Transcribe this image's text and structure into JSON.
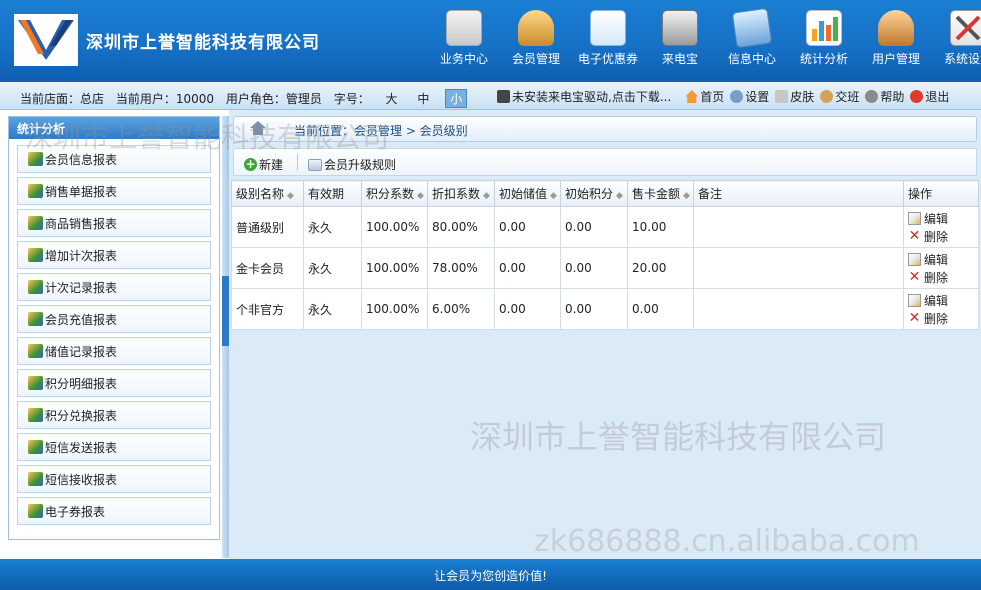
{
  "header": {
    "company": "深圳市上誉智能科技有限公司",
    "nav": [
      {
        "label": "业务中心",
        "icon": "business-icon"
      },
      {
        "label": "会员管理",
        "icon": "member-icon"
      },
      {
        "label": "电子优惠券",
        "icon": "coupon-icon"
      },
      {
        "label": "来电宝",
        "icon": "phone-icon"
      },
      {
        "label": "信息中心",
        "icon": "message-icon"
      },
      {
        "label": "统计分析",
        "icon": "chart-icon"
      },
      {
        "label": "用户管理",
        "icon": "users-icon"
      },
      {
        "label": "系统设置",
        "icon": "tools-icon"
      }
    ]
  },
  "infobar": {
    "store": "当前店面：总店",
    "user": "当前用户：10000",
    "role": "用户角色：管理员",
    "font_label": "字号：",
    "font_sizes": [
      "大",
      "中",
      "小"
    ],
    "phone_notice": "未安装来电宝驱动,点击下载...",
    "links": [
      "首页",
      "设置",
      "皮肤",
      "交班",
      "帮助",
      "退出"
    ]
  },
  "sidebar": {
    "title": "统计分析",
    "items": [
      "会员信息报表",
      "销售单据报表",
      "商品销售报表",
      "增加计次报表",
      "计次记录报表",
      "会员充值报表",
      "储值记录报表",
      "积分明细报表",
      "积分兑换报表",
      "短信发送报表",
      "短信接收报表",
      "电子券报表"
    ]
  },
  "main": {
    "breadcrumb": "当前位置：会员管理 > 会员级别",
    "toolbar": {
      "new": "新建",
      "upgrade_rules": "会员升级规则"
    },
    "columns": [
      "级别名称",
      "有效期",
      "积分系数",
      "折扣系数",
      "初始储值",
      "初始积分",
      "售卡金额",
      "备注",
      "操作"
    ],
    "rows": [
      [
        "普通级别",
        "永久",
        "100.00%",
        "80.00%",
        "0.00",
        "0.00",
        "10.00",
        ""
      ],
      [
        "金卡会员",
        "永久",
        "100.00%",
        "78.00%",
        "0.00",
        "0.00",
        "20.00",
        ""
      ],
      [
        "个非官方",
        "永久",
        "100.00%",
        "6.00%",
        "0.00",
        "0.00",
        "0.00",
        ""
      ]
    ],
    "row_actions": {
      "edit": "编辑",
      "delete": "删除"
    }
  },
  "footer": {
    "slogan": "让会员为您创造价值!"
  },
  "watermarks": [
    "深圳市上誉智能科技有限公司",
    "深圳市上誉智能科技有限公司",
    "zk686888.cn.alibaba.com"
  ],
  "colors": {
    "brand_blue": "#1671c6",
    "accent_light": "#dbeaf7",
    "delete_red": "#d12b2b"
  }
}
